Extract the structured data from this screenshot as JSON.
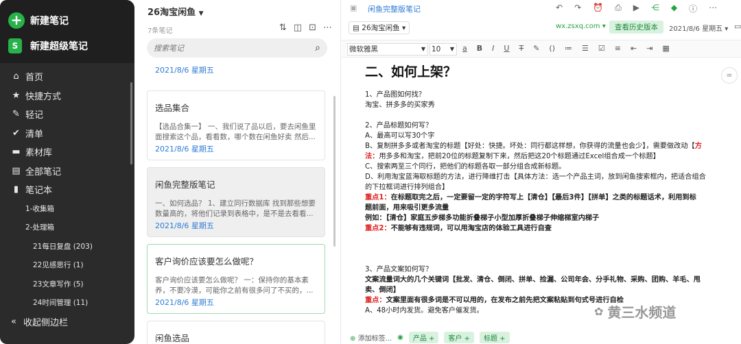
{
  "sidebar": {
    "new_note": "新建笔记",
    "new_super_note": "新建超级笔记",
    "items": [
      {
        "label": "首页",
        "icon": "home-icon"
      },
      {
        "label": "快捷方式",
        "icon": "star-icon"
      },
      {
        "label": "轻记",
        "icon": "pen-icon"
      },
      {
        "label": "清单",
        "icon": "check-circle-icon"
      },
      {
        "label": "素材库",
        "icon": "folder-icon"
      },
      {
        "label": "全部笔记",
        "icon": "notes-icon"
      },
      {
        "label": "笔记本",
        "icon": "notebook-icon"
      }
    ],
    "notebooks": [
      "1-收集箱",
      "2-处理箱"
    ],
    "subnotebooks": [
      "21每日复盘 (203)",
      "22见感思行 (1)",
      "23文章写作 (5)",
      "24时间管理 (11)"
    ],
    "collapse": "收起侧边栏"
  },
  "list": {
    "title": "26淘宝闲鱼",
    "count": "7条笔记",
    "search_placeholder": "搜索笔记",
    "top_date": "2021/8/6 星期五",
    "cards": [
      {
        "title": "选品集合",
        "body": "【选品合集一】 一、我们说了品以后，要去闲鱼里面搜索这个品，看看数，哪个数在闲鱼好卖 然后...",
        "date": "2021/8/6 星期五"
      },
      {
        "title": "闲鱼完整版笔记",
        "body": "一、如何选品？ 1、建立同行数据库 找到那些想要数量高的，将他们记录到表格中，是不是去看看...",
        "date": "2021/8/6 星期五"
      },
      {
        "title": "客户询价应该要怎么做呢？",
        "body": "客户询价应该要怎么做呢？ 一：保持你的基本素养，不要冷漠，可能你之前有很多问了不买的，...",
        "date": "2021/8/6 星期五"
      },
      {
        "title": "闲鱼选品",
        "body": "",
        "date": ""
      }
    ]
  },
  "editor": {
    "title": "闲鱼完整版笔记",
    "notebook": "26淘宝闲鱼",
    "site": "wx.zsxq.com",
    "history": "查看历史版本",
    "date": "2021/8/6 星期五",
    "font": "微软雅黑",
    "size": "10",
    "heading": "二、如何上架？",
    "lines": {
      "l1": "1、产品图如何找？",
      "l2": "淘宝、拼多多的买家秀",
      "l3": "2、产品标题如何写？",
      "l4": "A、最高可以写30个字",
      "l5a": "B、复制拼多多或者淘宝的标题【好处：快捷。坏处：同行都这样想，你获得的流量也会少】，需要做改动【",
      "l5b": "方",
      "l6a": "法：",
      "l6b": "用多多和淘宝，把前20位的标题复制下来，然后把这20个标题通过Excel组合成一个标题】",
      "l7": "C、搜索两至三个同行，把他们的标题各取一部分组合成新标题。",
      "l8": "D、利用淘宝蓝海取标题的方法，进行降维打击【具体方法：选一个产品主词，放到闲鱼搜索框内，把适合组合",
      "l9": "的下拉框词进行排列组合】",
      "l10a": "重点1：",
      "l10b": "在标题取完之后，一定要留一定的字符写上【清仓】【最后3件】【拼单】之类的标题话术，利用到标",
      "l11": "题前面，用来吸引更多流量",
      "l12": "例如：【清仓】家庭五步梯多功能折叠梯子小型加厚折叠梯子伸缩梯室内梯子",
      "l13a": "重点2：",
      "l13b": "不能够有违规词，可以用淘宝店的体验工具进行自查",
      "l14": "3、产品文案如何写？",
      "l15": "文案流量词大的几个关键词【批发、清仓、倒闭、拼单、捡漏、公司年会、分手礼物、采购、团购、羊毛、甩",
      "l16": "卖、倒闭】",
      "l17a": "重点：",
      "l17b": "文案里面有很多词是不可以用的，在发布之前先把文案粘贴到句式",
      "l17c": "号进行自检",
      "l18": "A、48小时内发货。避免客户催发货。"
    },
    "tag_add": "添加标签...",
    "tags": [
      "产品 +",
      "客户 +",
      "标题 +"
    ],
    "watermark": "黄三水频道"
  }
}
